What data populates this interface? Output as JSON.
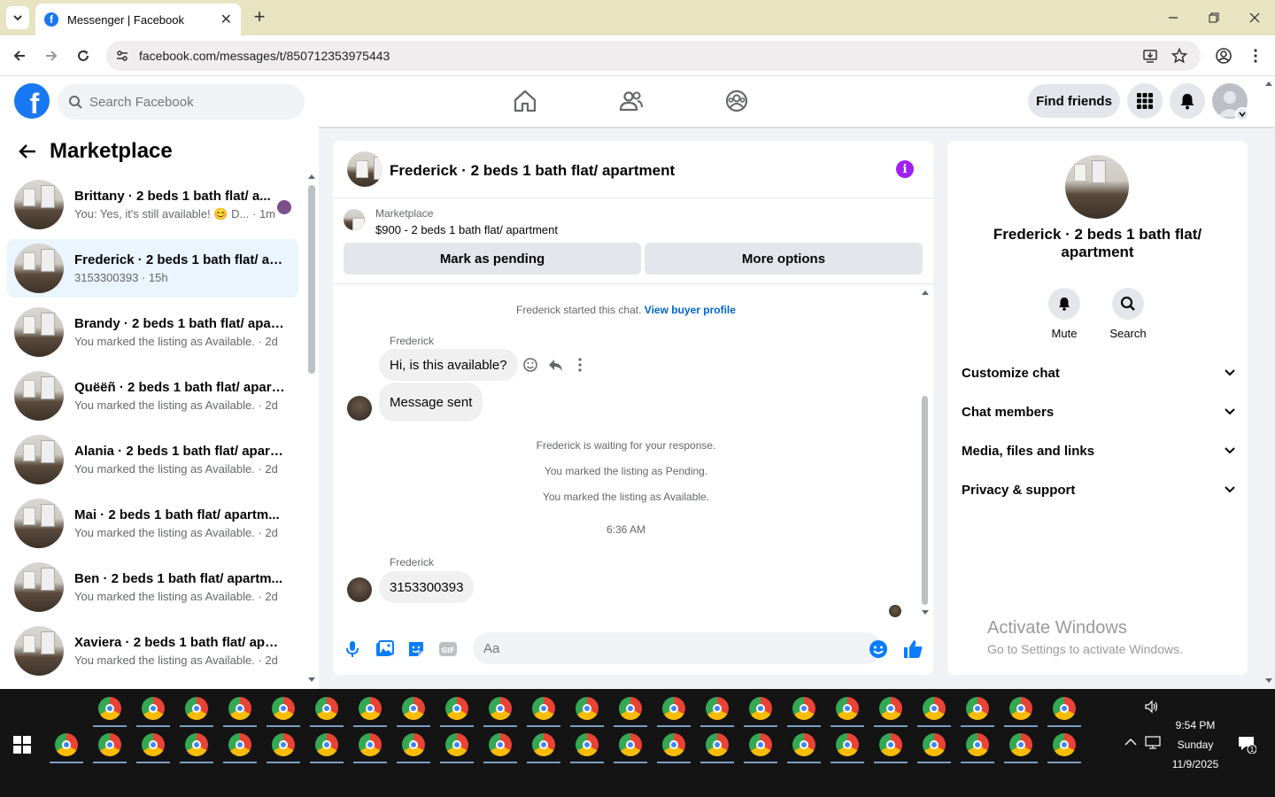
{
  "browser": {
    "tab_title": "Messenger | Facebook",
    "url": "facebook.com/messages/t/850712353975443"
  },
  "fb": {
    "search_placeholder": "Search Facebook",
    "find_friends": "Find friends"
  },
  "sidebar": {
    "title": "Marketplace",
    "conversations": [
      {
        "name": "Brittany · 2 beds 1 bath flat/ a...",
        "sub": "You: Yes, it's still available! 😊 D... · 1m",
        "active": false,
        "unread": true
      },
      {
        "name": "Frederick · 2 beds 1 bath flat/ ap...",
        "sub": "3153300393 · 15h",
        "active": true,
        "unread": false
      },
      {
        "name": "Brandy · 2 beds 1 bath flat/ apar...",
        "sub": "You marked the listing as Available. · 2d",
        "active": false,
        "unread": false
      },
      {
        "name": "Quëëñ · 2 beds 1 bath flat/ apart...",
        "sub": "You marked the listing as Available. · 2d",
        "active": false,
        "unread": false
      },
      {
        "name": "Alania · 2 beds 1 bath flat/ apart...",
        "sub": "You marked the listing as Available. · 2d",
        "active": false,
        "unread": false
      },
      {
        "name": "Mai · 2 beds 1 bath flat/ apartm...",
        "sub": "You marked the listing as Available. · 2d",
        "active": false,
        "unread": false
      },
      {
        "name": "Ben · 2 beds 1 bath flat/ apartm...",
        "sub": "You marked the listing as Available. · 2d",
        "active": false,
        "unread": false
      },
      {
        "name": "Xaviera · 2 beds 1 bath flat/ apar...",
        "sub": "You marked the listing as Available. · 2d",
        "active": false,
        "unread": false
      }
    ]
  },
  "chat": {
    "title": "Frederick · 2 beds 1 bath flat/ apartment",
    "marketplace_label": "Marketplace",
    "listing": "$900 - 2 beds 1 bath flat/ apartment",
    "mark_pending": "Mark as pending",
    "more_options": "More options",
    "started": "Frederick started this chat.",
    "view_buyer": "View buyer profile",
    "sender1": "Frederick",
    "msg1": "Hi, is this available?",
    "msg2": "Message sent",
    "sys1": "Frederick is waiting for your response.",
    "sys2": "You marked the listing as Pending.",
    "sys3": "You marked the listing as Available.",
    "time": "6:36 AM",
    "sender2": "Frederick",
    "msg3": "3153300393",
    "composer_placeholder": "Aa"
  },
  "right": {
    "name_line1": "Frederick · 2 beds 1 bath flat/",
    "name_line2": "apartment",
    "mute": "Mute",
    "search": "Search",
    "sections": [
      "Customize chat",
      "Chat members",
      "Media, files and links",
      "Privacy & support"
    ]
  },
  "watermark": {
    "line1": "Activate Windows",
    "line2": "Go to Settings to activate Windows."
  },
  "taskbar": {
    "time": "9:54 PM",
    "day": "Sunday",
    "date": "11/9/2025",
    "notification_count": "1"
  },
  "colors": {
    "fb_blue": "#1877f2",
    "info_purple": "#a020f0",
    "active_conv": "#ebf5ff",
    "link_blue": "#0064d1"
  }
}
